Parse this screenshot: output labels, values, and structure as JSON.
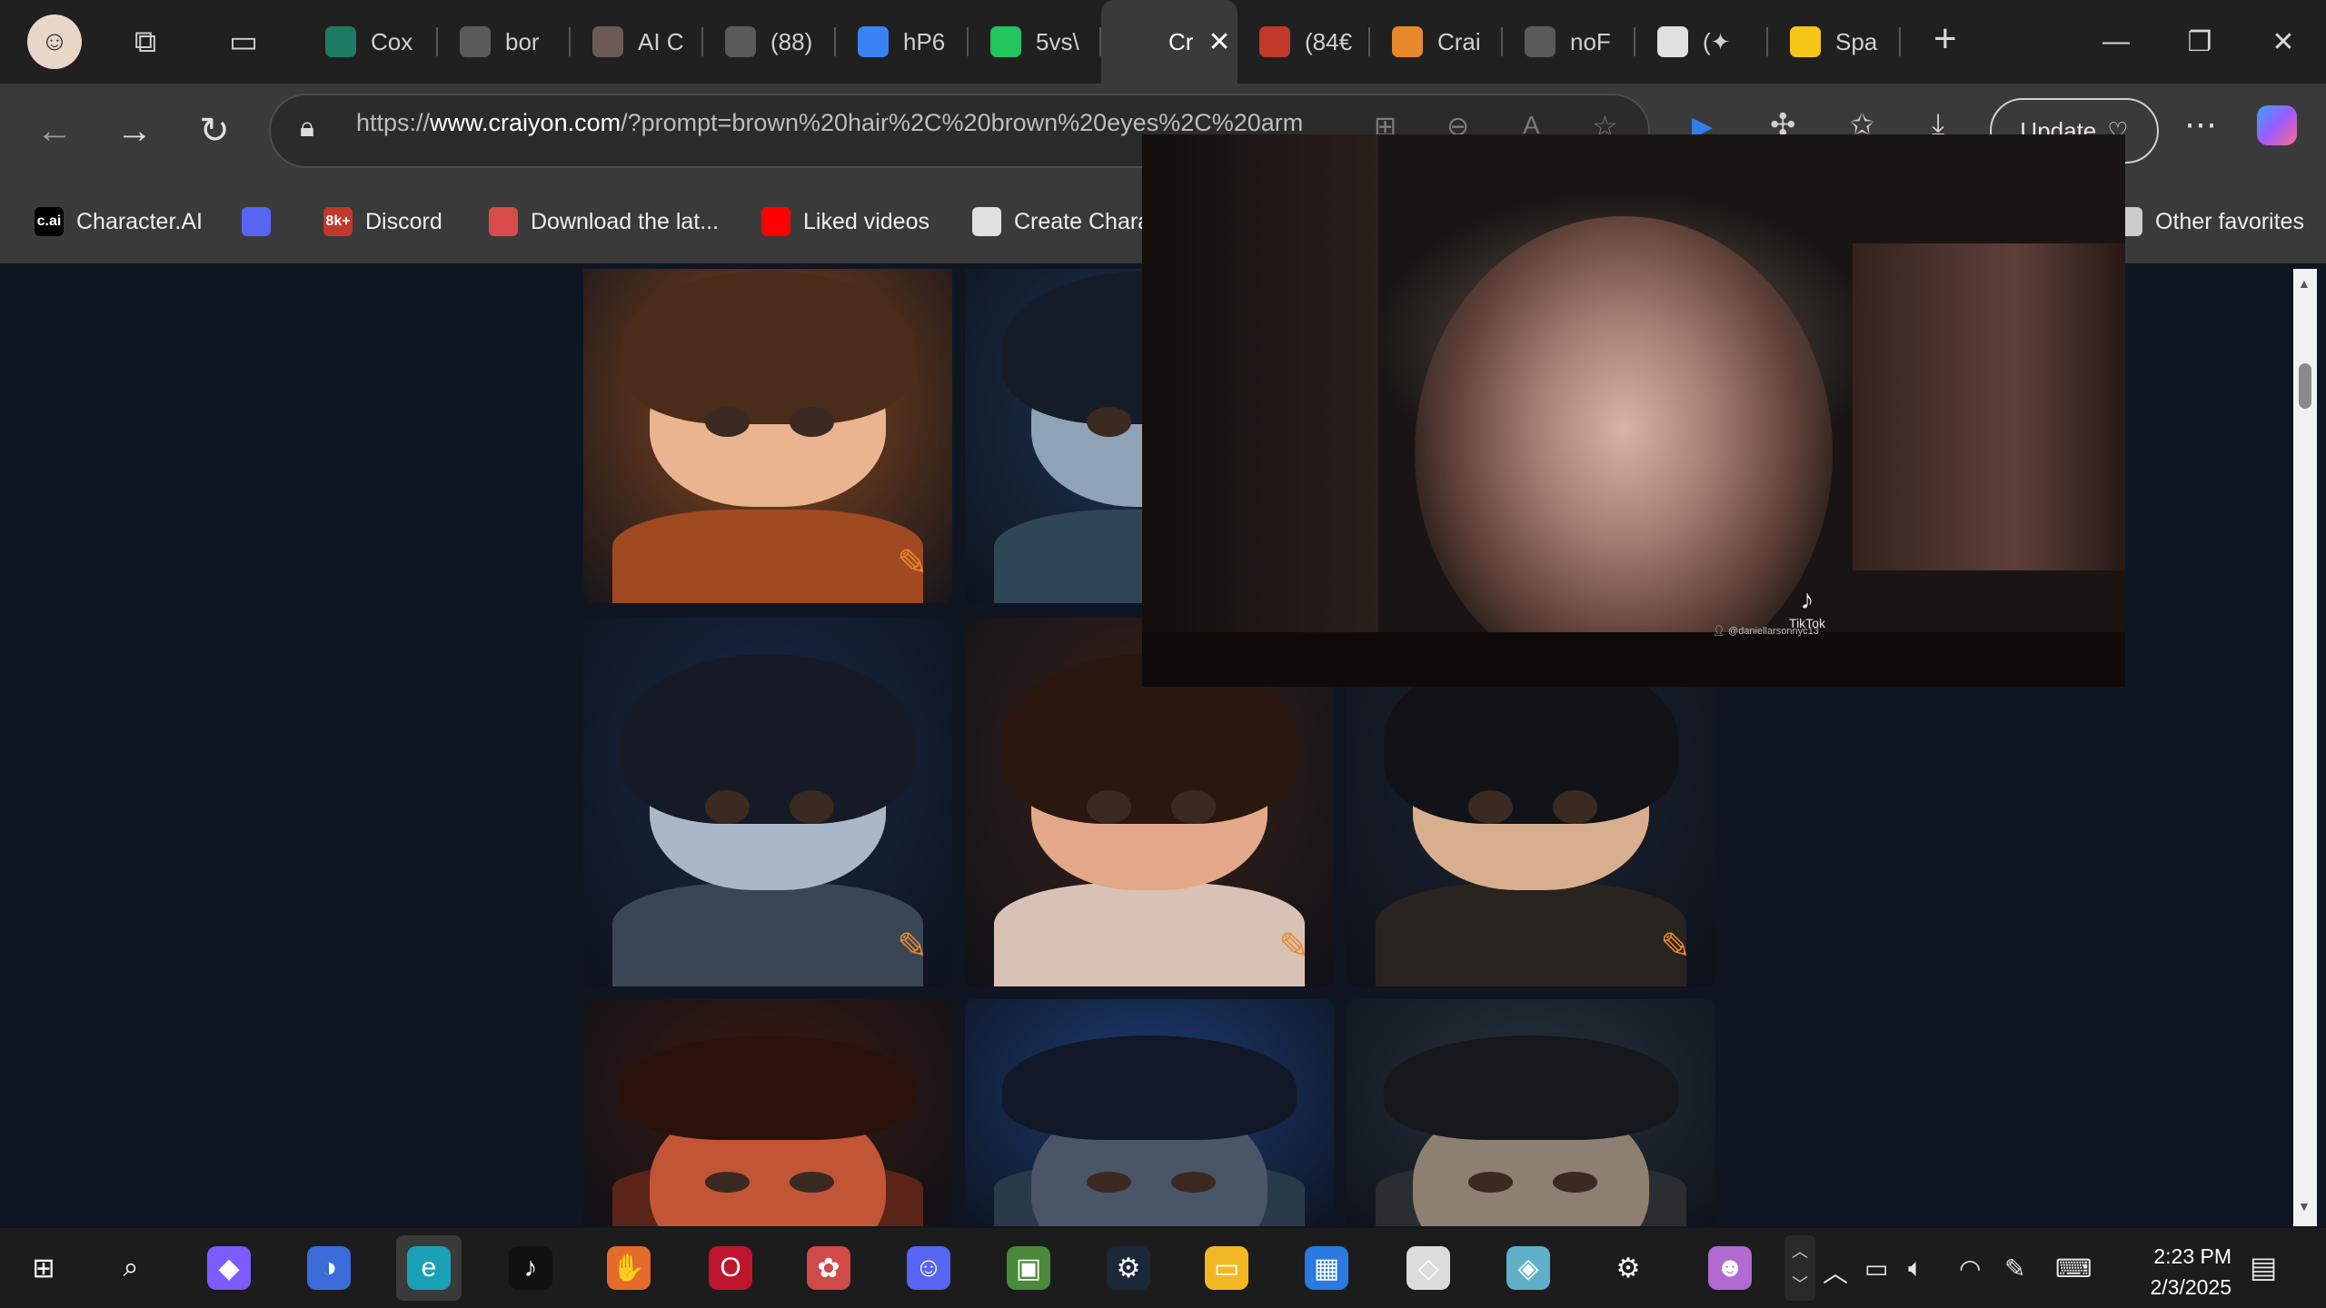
{
  "tabs": [
    {
      "label": "Cox",
      "icon": "globe-icon",
      "color": "#1e7b63"
    },
    {
      "label": "bor",
      "icon": "document-icon",
      "color": "#5a5a5a"
    },
    {
      "label": "AI C",
      "icon": "photo-avatar-icon",
      "color": "#6b5a55"
    },
    {
      "label": "(88)",
      "icon": "video-icon",
      "color": "#5a5a5a"
    },
    {
      "label": "hP6",
      "icon": "pinwheel-icon",
      "color": "#3b82f6"
    },
    {
      "label": "5vs\\",
      "icon": "pinwheel-icon",
      "color": "#22c55e"
    },
    {
      "label": "Cr",
      "icon": "craiyon-icon",
      "color": "#3a3a3a",
      "active": true
    },
    {
      "label": "(84€",
      "icon": "8k-icon",
      "color": "#c0392b"
    },
    {
      "label": "Crai",
      "icon": "pencil-icon",
      "color": "#e8892c"
    },
    {
      "label": "noF",
      "icon": "document-icon",
      "color": "#5a5a5a"
    },
    {
      "label": "(✦",
      "icon": "roblox-icon",
      "color": "#e0e0e0"
    },
    {
      "label": "Spa",
      "icon": "hugging-face-icon",
      "color": "#f5c518"
    }
  ],
  "address": {
    "url_prefix": "https://",
    "url_host": "www.craiyon.com",
    "url_rest": "/?prompt=brown%20hair%2C%20brown%20eyes%2C%20arm",
    "update_label": "Update"
  },
  "bookmarks": [
    {
      "label": "Character.AI",
      "icon": "c.ai",
      "color": "#000000"
    },
    {
      "label": "",
      "icon": "discord-icon",
      "color": "#5865f2"
    },
    {
      "label": "Discord",
      "icon": "8k+",
      "color": "#c0392b"
    },
    {
      "label": "Download the lat...",
      "icon": "store-icon",
      "color": "#d94a4a"
    },
    {
      "label": "Liked videos",
      "icon": "youtube-icon",
      "color": "#ff0000"
    },
    {
      "label": "Create Charac",
      "icon": "openai-icon",
      "color": "#e0e0e0"
    },
    {
      "label": "Other favorites",
      "icon": "folder-icon",
      "color": "#cccccc"
    }
  ],
  "gallery": {
    "rows": [
      [
        {
          "hair": "#4a2c1a",
          "skin": "#e9b48f",
          "bg": "#8a4a22",
          "shirt": "#a14a22",
          "pencil": true
        },
        {
          "hair": "#161b28",
          "skin": "#8ea3b5",
          "bg": "#1f3554",
          "shirt": "#2e4656",
          "pencil": false
        }
      ],
      [
        {
          "hair": "#151a26",
          "skin": "#a9b7c9",
          "bg": "#1a2a48",
          "shirt": "#3a4654",
          "pencil": true
        },
        {
          "hair": "#2a1710",
          "skin": "#e3a889",
          "bg": "#3a2218",
          "shirt": "#d8c2b6",
          "pencil": true
        },
        {
          "hair": "#111318",
          "skin": "#d8ae8f",
          "bg": "#1d2533",
          "shirt": "#2a2420",
          "pencil": true
        }
      ],
      [
        {
          "hair": "#2a120a",
          "skin": "#c25536",
          "bg": "#3a1a10",
          "shirt": "#5a2418",
          "pencil": false
        },
        {
          "hair": "#121827",
          "skin": "#4a5568",
          "bg": "#1d3e78",
          "shirt": "#2a3a4a",
          "pencil": false
        },
        {
          "hair": "#15181c",
          "skin": "#8d8072",
          "bg": "#28333d",
          "shirt": "#2a2e30",
          "pencil": false
        }
      ]
    ]
  },
  "video": {
    "logo_text": "TikTok",
    "handle": "@daniellarsonnyc13"
  },
  "taskbar": {
    "apps": [
      {
        "name": "start-button",
        "glyph": "⊞",
        "color": "#1c1c1c"
      },
      {
        "name": "search-button",
        "glyph": "⌕",
        "color": "#1c1c1c"
      },
      {
        "name": "copilot-app",
        "glyph": "◆",
        "color": "#7c5cff"
      },
      {
        "name": "ball-app",
        "glyph": "◑",
        "color": "#3a6bd8"
      },
      {
        "name": "edge-app",
        "glyph": "e",
        "color": "#1aa1b8",
        "active": true
      },
      {
        "name": "tiktok-app",
        "glyph": "♪",
        "color": "#111111"
      },
      {
        "name": "hand-app",
        "glyph": "✋",
        "color": "#e46b2c"
      },
      {
        "name": "opera-app",
        "glyph": "O",
        "color": "#c0152f"
      },
      {
        "name": "paint-app",
        "glyph": "✿",
        "color": "#d04a4a"
      },
      {
        "name": "discord-app",
        "glyph": "☺",
        "color": "#5865f2"
      },
      {
        "name": "minecraft-app",
        "glyph": "▣",
        "color": "#4a8a3a"
      },
      {
        "name": "steam-app",
        "glyph": "⚙",
        "color": "#1b2838"
      },
      {
        "name": "explorer-app",
        "glyph": "▭",
        "color": "#f2b824"
      },
      {
        "name": "store-app",
        "glyph": "▦",
        "color": "#2a7ae2"
      },
      {
        "name": "roblox-app",
        "glyph": "◇",
        "color": "#dcdcdc"
      },
      {
        "name": "cube-app",
        "glyph": "◈",
        "color": "#5fb0c8"
      },
      {
        "name": "settings-app",
        "glyph": "⚙",
        "color": "#1c1c1c"
      },
      {
        "name": "avatar-app",
        "glyph": "☻",
        "color": "#b06ad0"
      }
    ],
    "time": "2:23 PM",
    "date": "2/3/2025"
  }
}
